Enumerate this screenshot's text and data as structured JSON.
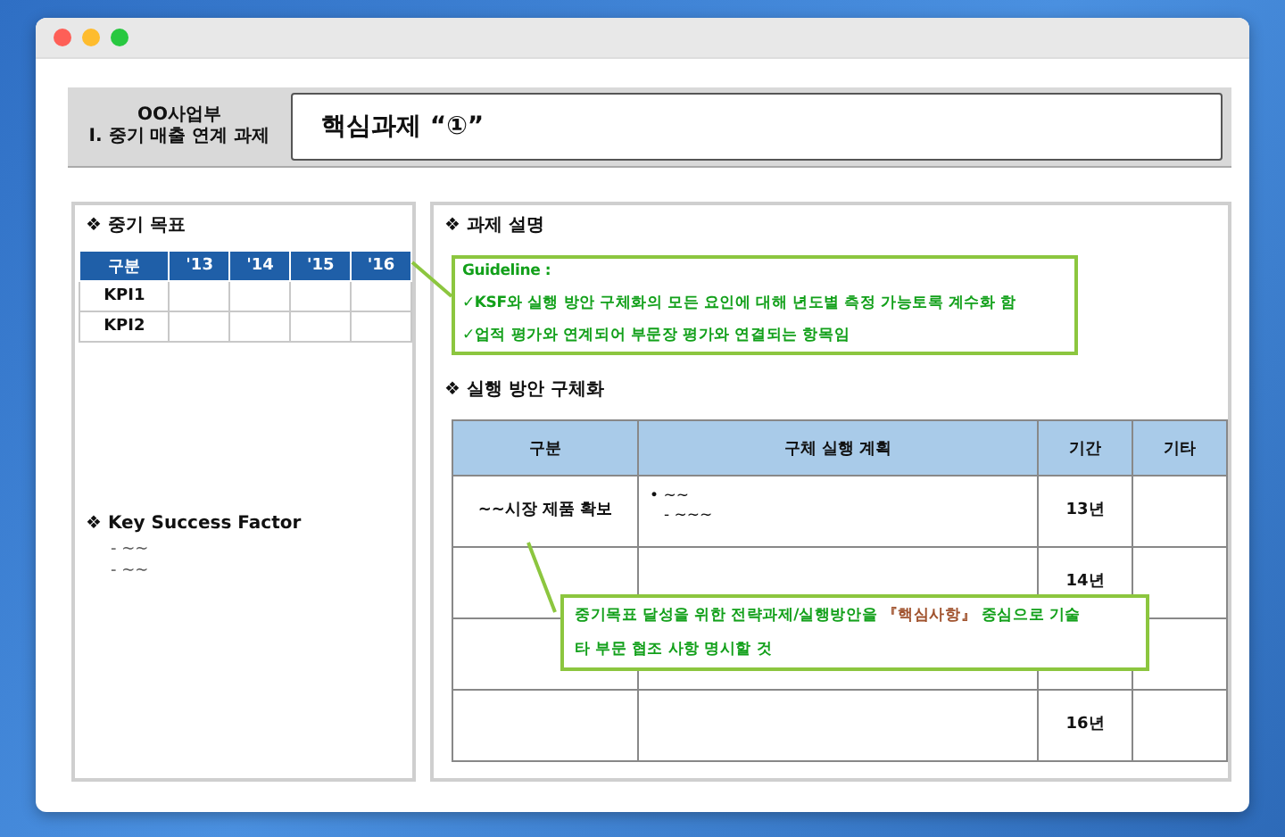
{
  "header": {
    "department": "OO사업부",
    "section": "Ⅰ. 중기 매출 연계 과제",
    "title": "핵심과제 “①”"
  },
  "left_panel": {
    "goal_heading": "❖ 중기 목표",
    "kpi_table": {
      "columns": [
        "구분",
        "'13",
        "'14",
        "'15",
        "'16"
      ],
      "rows": [
        {
          "label": "KPI1"
        },
        {
          "label": "KPI2"
        }
      ]
    },
    "ksf": {
      "heading": "❖ Key Success Factor",
      "items": [
        "- ~~",
        "- ~~"
      ]
    }
  },
  "right_panel": {
    "description_heading": "❖ 과제 설명",
    "guideline": {
      "title": "Guideline :",
      "items": [
        "✓KSF와 실행 방안 구체화의 모든 요인에 대해 년도별 측정 가능토록 계수화 함",
        "✓업적 평가와 연계되어 부문장 평가와 연결되는 항목임"
      ]
    },
    "plan_heading": "❖ 실행 방안 구체화",
    "plan_table": {
      "columns": [
        "구분",
        "구체 실행 계획",
        "기간",
        "기타"
      ],
      "rows": [
        {
          "category": "~~시장 제품 확보",
          "plan": "• ~~",
          "sub_plan": "- ~~~",
          "period": "13년"
        },
        {
          "period": "14년"
        },
        {},
        {
          "period": "16년"
        }
      ]
    },
    "callout": {
      "items": [
        [
          {
            "text": "중기목표 달성을 위한 전략과제/실행방안을 ",
            "highlight": false
          },
          {
            "text": "『핵심사항』",
            "highlight": true
          },
          {
            "text": " 중심으로 기술",
            "highlight": false
          }
        ],
        [
          {
            "text": "타 부문 협조 사항 명시할 것",
            "highlight": false
          }
        ]
      ]
    }
  }
}
